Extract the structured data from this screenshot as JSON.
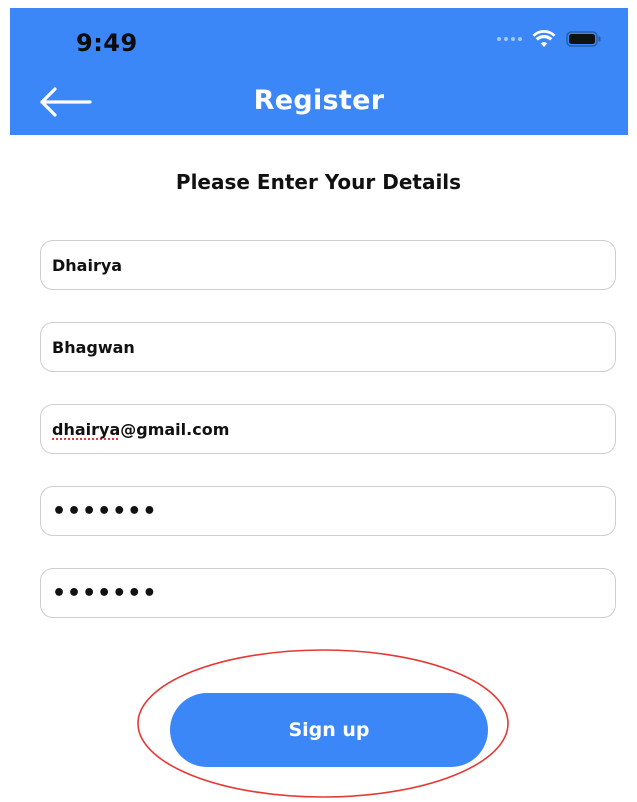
{
  "status_bar": {
    "time": "9:49"
  },
  "app_bar": {
    "title": "Register",
    "back_icon": "arrow-left-icon"
  },
  "form": {
    "heading": "Please Enter Your Details",
    "first_name": {
      "value_spell": "",
      "value_rest": "Dhairya"
    },
    "last_name": {
      "value": "Bhagwan"
    },
    "email": {
      "value_spell": "dhairya",
      "value_rest": "@gmail.com"
    },
    "password": {
      "value": "•••••••"
    },
    "confirm_password": {
      "value": "•••••••"
    }
  },
  "actions": {
    "signup_label": "Sign up"
  },
  "colors": {
    "primary": "#3b87f7",
    "annotation": "#e53935"
  }
}
